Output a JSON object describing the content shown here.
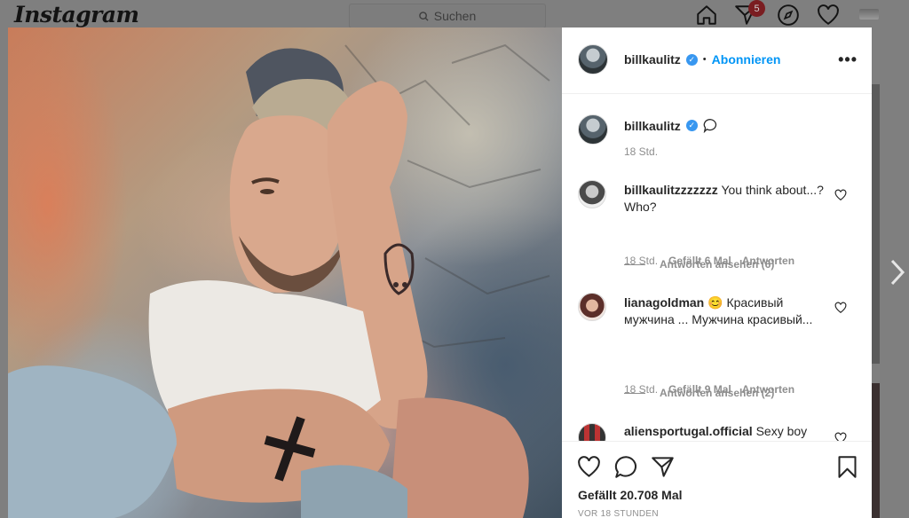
{
  "nav": {
    "logo": "Instagram",
    "search_placeholder": "Suchen",
    "notification_count": "5",
    "icons": [
      "home-icon",
      "direct-icon",
      "explore-icon",
      "activity-icon",
      "profile-avatar"
    ]
  },
  "post": {
    "author": "billkaulitz",
    "follow_label": "Abonnieren",
    "separator": "•",
    "more_label": "•••",
    "caption_time": "18 Std.",
    "likes": "Gefällt 20.708 Mal",
    "time_ago": "VOR 18 STUNDEN"
  },
  "comments": [
    {
      "user": "billkaulitzzzzzzz",
      "text": "You think about...? Who?",
      "time": "18 Std.",
      "likes": "Gefällt 6 Mal",
      "reply": "Antworten",
      "view_replies": "Antworten ansehen (6)"
    },
    {
      "user": "lianagoldman",
      "emoji": "😊",
      "text": "Красивый мужчина ... Мужчина красивый...",
      "time": "18 Std.",
      "likes": "Gefällt 9 Mal",
      "reply": "Antworten",
      "view_replies": "Antworten ansehen (2)"
    },
    {
      "user": "aliensportugal.official",
      "text": "Sexy boy"
    }
  ],
  "colors": {
    "accent": "#0095f6",
    "verified": "#3897f0",
    "text": "#262626",
    "muted": "#8e8e8e",
    "overlay": "#7f7f7f"
  }
}
